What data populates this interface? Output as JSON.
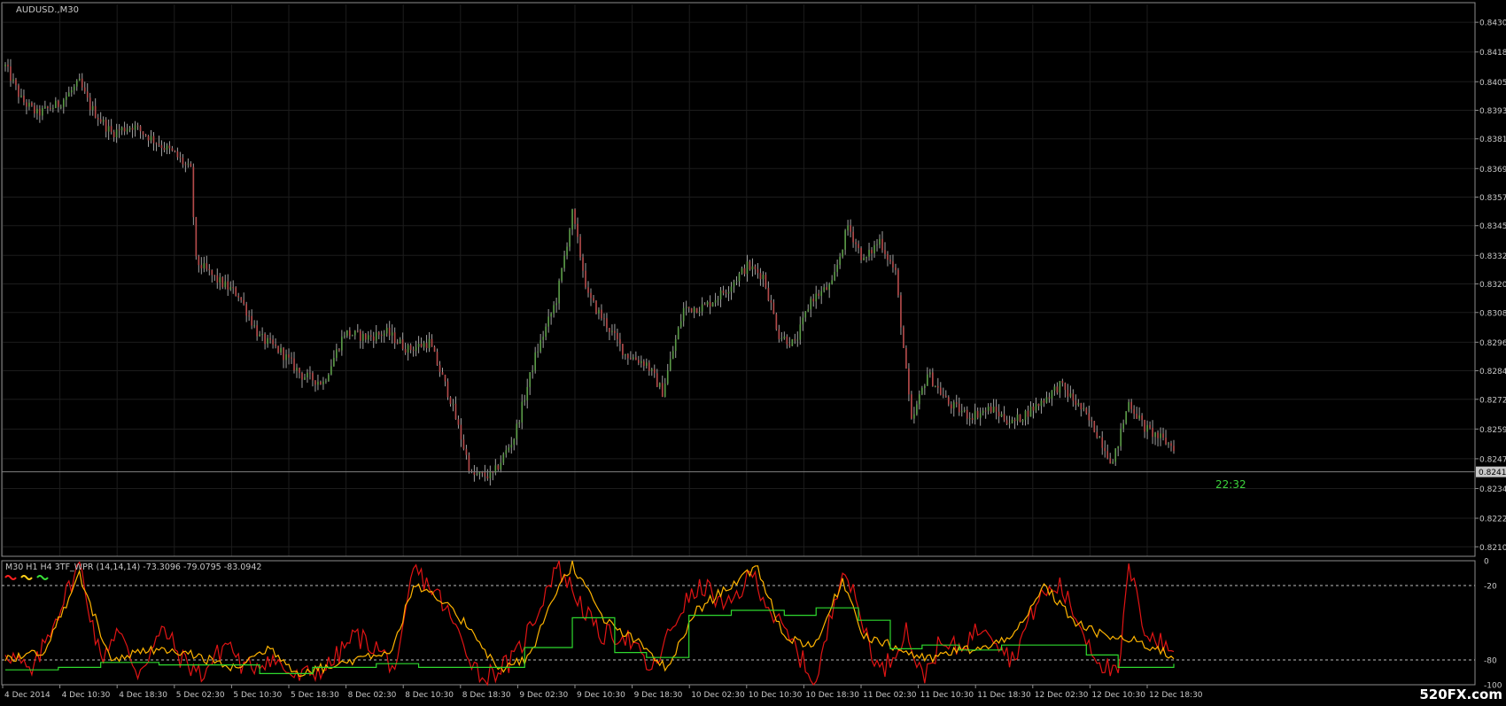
{
  "colors": {
    "background": "#000000",
    "frame": "#8c8c8c",
    "grid": "#1c1c1c",
    "axis_text": "#c8c8c8",
    "bull_candle": "#5a9a46",
    "bear_candle": "#b44a4a",
    "wick": "#a0a0a0",
    "price_line": "#808080",
    "price_tag_bg": "#c8c8c8",
    "timer": "#3cd23c",
    "level_line": "#bdbdbd",
    "watermark": "#ffffff"
  },
  "main_chart": {
    "symbol_label": "AUDUSD.,M30",
    "current_price": 0.82415,
    "current_price_label": "0.82415",
    "timer_label": "22:32",
    "y_range": [
      0.8206,
      0.8438
    ],
    "y_ticks": [
      "0.84305",
      "0.84180",
      "0.84055",
      "0.83935",
      "0.83815",
      "0.83690",
      "0.83570",
      "0.83450",
      "0.83325",
      "0.83205",
      "0.83085",
      "0.82960",
      "0.82840",
      "0.82720",
      "0.82595",
      "0.82470",
      "0.82345",
      "0.82220",
      "0.82100"
    ]
  },
  "indicator": {
    "label": "M30 H1 H4 3TF_WPR (14,14,14) -73.3096 -79.0795 -83.0942",
    "legend_colors": [
      "#ff2020",
      "#ffd21a",
      "#38e038"
    ],
    "y_range": [
      -100,
      0
    ],
    "y_ticks": [
      "0",
      "-20",
      "-80",
      "-100"
    ],
    "levels": [
      -20,
      -80
    ],
    "series_colors": {
      "m30": "#e01414",
      "h1": "#ffb400",
      "h4": "#2ed82e"
    }
  },
  "x_ticks": [
    "4 Dec 2014",
    "4 Dec 10:30",
    "4 Dec 18:30",
    "5 Dec 02:30",
    "5 Dec 10:30",
    "5 Dec 18:30",
    "8 Dec 02:30",
    "8 Dec 10:30",
    "8 Dec 18:30",
    "9 Dec 02:30",
    "9 Dec 10:30",
    "9 Dec 18:30",
    "10 Dec 02:30",
    "10 Dec 10:30",
    "10 Dec 18:30",
    "11 Dec 02:30",
    "11 Dec 10:30",
    "11 Dec 18:30",
    "12 Dec 02:30",
    "12 Dec 10:30",
    "12 Dec 18:30"
  ],
  "watermark": "520FX.com",
  "chart_data": [
    {
      "type": "candlestick",
      "title": "AUDUSD.,M30",
      "anchors": [
        [
          0,
          0.8412
        ],
        [
          6,
          0.8398
        ],
        [
          12,
          0.8392
        ],
        [
          20,
          0.8396
        ],
        [
          28,
          0.8405
        ],
        [
          32,
          0.8395
        ],
        [
          40,
          0.8384
        ],
        [
          48,
          0.8387
        ],
        [
          56,
          0.8381
        ],
        [
          64,
          0.8375
        ],
        [
          70,
          0.8368
        ],
        [
          72,
          0.833
        ],
        [
          80,
          0.8322
        ],
        [
          88,
          0.8316
        ],
        [
          96,
          0.8298
        ],
        [
          104,
          0.8292
        ],
        [
          112,
          0.8282
        ],
        [
          120,
          0.8279
        ],
        [
          128,
          0.83
        ],
        [
          136,
          0.8298
        ],
        [
          144,
          0.83
        ],
        [
          152,
          0.8293
        ],
        [
          160,
          0.8296
        ],
        [
          168,
          0.8272
        ],
        [
          176,
          0.824
        ],
        [
          184,
          0.824
        ],
        [
          192,
          0.8256
        ],
        [
          200,
          0.829
        ],
        [
          208,
          0.8314
        ],
        [
          214,
          0.835
        ],
        [
          220,
          0.8315
        ],
        [
          226,
          0.8305
        ],
        [
          234,
          0.8291
        ],
        [
          242,
          0.8287
        ],
        [
          248,
          0.8275
        ],
        [
          256,
          0.831
        ],
        [
          264,
          0.8311
        ],
        [
          272,
          0.8318
        ],
        [
          280,
          0.8328
        ],
        [
          286,
          0.8324
        ],
        [
          292,
          0.8299
        ],
        [
          298,
          0.8295
        ],
        [
          304,
          0.8314
        ],
        [
          312,
          0.832
        ],
        [
          318,
          0.8345
        ],
        [
          324,
          0.833
        ],
        [
          330,
          0.8339
        ],
        [
          336,
          0.8325
        ],
        [
          342,
          0.8262
        ],
        [
          348,
          0.8283
        ],
        [
          356,
          0.827
        ],
        [
          364,
          0.8265
        ],
        [
          372,
          0.8268
        ],
        [
          380,
          0.8262
        ],
        [
          390,
          0.827
        ],
        [
          398,
          0.8278
        ],
        [
          406,
          0.8268
        ],
        [
          412,
          0.8258
        ],
        [
          418,
          0.8245
        ],
        [
          424,
          0.8271
        ],
        [
          430,
          0.826
        ],
        [
          438,
          0.8254
        ],
        [
          441,
          0.8252
        ]
      ],
      "y_range": [
        0.8206,
        0.8438
      ]
    },
    {
      "type": "line",
      "title": "M30 H1 H4 3TF_WPR (14,14,14)",
      "series": [
        {
          "name": "M30",
          "points": [
            [
              0,
              -72
            ],
            [
              10,
              -92
            ],
            [
              18,
              -50
            ],
            [
              28,
              -3
            ],
            [
              36,
              -80
            ],
            [
              42,
              -55
            ],
            [
              50,
              -90
            ],
            [
              60,
              -55
            ],
            [
              66,
              -78
            ],
            [
              74,
              -92
            ],
            [
              84,
              -65
            ],
            [
              90,
              -88
            ],
            [
              100,
              -78
            ],
            [
              110,
              -95
            ],
            [
              122,
              -85
            ],
            [
              132,
              -60
            ],
            [
              140,
              -70
            ],
            [
              148,
              -88
            ],
            [
              154,
              -6
            ],
            [
              164,
              -30
            ],
            [
              170,
              -55
            ],
            [
              180,
              -95
            ],
            [
              192,
              -80
            ],
            [
              200,
              -45
            ],
            [
              208,
              -3
            ],
            [
              216,
              -30
            ],
            [
              224,
              -60
            ],
            [
              234,
              -60
            ],
            [
              244,
              -90
            ],
            [
              250,
              -62
            ],
            [
              256,
              -35
            ],
            [
              264,
              -20
            ],
            [
              272,
              -40
            ],
            [
              282,
              -10
            ],
            [
              290,
              -45
            ],
            [
              298,
              -70
            ],
            [
              306,
              -100
            ],
            [
              316,
              -2
            ],
            [
              322,
              -40
            ],
            [
              330,
              -90
            ],
            [
              334,
              -80
            ],
            [
              340,
              -55
            ],
            [
              346,
              -95
            ],
            [
              352,
              -70
            ],
            [
              360,
              -70
            ],
            [
              370,
              -50
            ],
            [
              380,
              -80
            ],
            [
              390,
              -30
            ],
            [
              398,
              -20
            ],
            [
              404,
              -45
            ],
            [
              412,
              -78
            ],
            [
              420,
              -95
            ],
            [
              424,
              -5
            ],
            [
              430,
              -55
            ],
            [
              438,
              -70
            ],
            [
              441,
              -73.3
            ]
          ]
        },
        {
          "name": "H1",
          "points": [
            [
              0,
              -78
            ],
            [
              14,
              -75
            ],
            [
              28,
              -12
            ],
            [
              40,
              -80
            ],
            [
              56,
              -72
            ],
            [
              70,
              -75
            ],
            [
              86,
              -87
            ],
            [
              100,
              -70
            ],
            [
              110,
              -90
            ],
            [
              124,
              -85
            ],
            [
              134,
              -78
            ],
            [
              146,
              -72
            ],
            [
              154,
              -20
            ],
            [
              164,
              -32
            ],
            [
              176,
              -55
            ],
            [
              186,
              -88
            ],
            [
              198,
              -78
            ],
            [
              206,
              -32
            ],
            [
              214,
              -3
            ],
            [
              226,
              -48
            ],
            [
              240,
              -68
            ],
            [
              250,
              -88
            ],
            [
              260,
              -42
            ],
            [
              272,
              -22
            ],
            [
              284,
              -6
            ],
            [
              294,
              -62
            ],
            [
              306,
              -68
            ],
            [
              316,
              -15
            ],
            [
              324,
              -60
            ],
            [
              336,
              -70
            ],
            [
              348,
              -80
            ],
            [
              360,
              -72
            ],
            [
              372,
              -70
            ],
            [
              384,
              -52
            ],
            [
              392,
              -20
            ],
            [
              404,
              -50
            ],
            [
              414,
              -60
            ],
            [
              426,
              -65
            ],
            [
              436,
              -72
            ],
            [
              441,
              -79.08
            ]
          ]
        },
        {
          "name": "H4",
          "points": [
            [
              0,
              -88
            ],
            [
              20,
              -86
            ],
            [
              36,
              -82
            ],
            [
              58,
              -84
            ],
            [
              78,
              -84
            ],
            [
              96,
              -91
            ],
            [
              116,
              -86
            ],
            [
              140,
              -83
            ],
            [
              156,
              -86
            ],
            [
              176,
              -86
            ],
            [
              196,
              -70
            ],
            [
              214,
              -46
            ],
            [
              230,
              -74
            ],
            [
              242,
              -78
            ],
            [
              258,
              -44
            ],
            [
              274,
              -40
            ],
            [
              294,
              -44
            ],
            [
              306,
              -38
            ],
            [
              322,
              -48
            ],
            [
              334,
              -71
            ],
            [
              346,
              -68
            ],
            [
              360,
              -72
            ],
            [
              376,
              -68
            ],
            [
              394,
              -68
            ],
            [
              408,
              -76
            ],
            [
              420,
              -86
            ],
            [
              441,
              -83.09
            ]
          ]
        }
      ],
      "levels": [
        -20,
        -80
      ],
      "ylim": [
        -100,
        0
      ]
    }
  ]
}
